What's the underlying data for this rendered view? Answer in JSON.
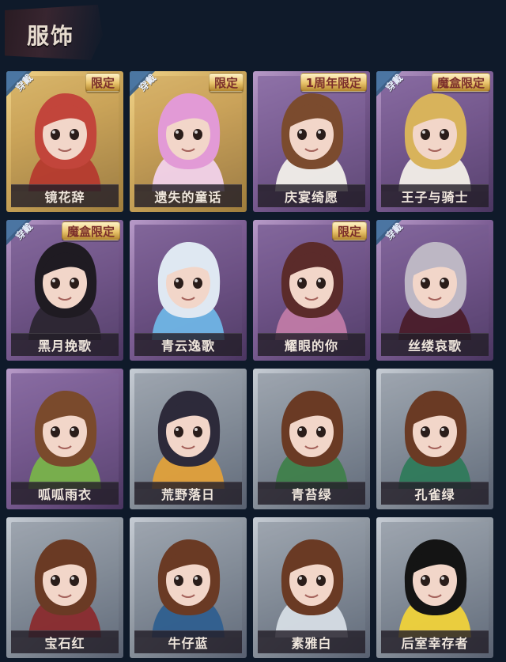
{
  "page": {
    "title": "服饰"
  },
  "badges": {
    "worn": "穿戴"
  },
  "items": [
    {
      "name": "镜花辞",
      "frame": "gold",
      "worn": true,
      "limited": "限定",
      "hair": "#c2453b",
      "outfit": "#b53a2e",
      "bg": "#d8b46a"
    },
    {
      "name": "遗失的童话",
      "frame": "gold",
      "worn": true,
      "limited": "限定",
      "hair": "#e29ad6",
      "outfit": "#f1d2ea",
      "bg": "#d6b26c"
    },
    {
      "name": "庆宴绮愿",
      "frame": "purple",
      "worn": false,
      "limited": "1周年限定",
      "hair": "#7b4b2e",
      "outfit": "#f2f0ea",
      "bg": "#8b6fa6"
    },
    {
      "name": "王子与骑士",
      "frame": "purple",
      "worn": true,
      "limited": "魔盒限定",
      "hair": "#d8b35b",
      "outfit": "#f3efe8",
      "bg": "#7c5f95"
    },
    {
      "name": "黑月挽歌",
      "frame": "purple",
      "worn": true,
      "limited": "魔盒限定",
      "hair": "#1f1b22",
      "outfit": "#2b2530",
      "bg": "#73588a"
    },
    {
      "name": "青云逸歌",
      "frame": "purple",
      "worn": false,
      "limited": "",
      "hair": "#dfe8f2",
      "outfit": "#6fb5e6",
      "bg": "#6a4f82"
    },
    {
      "name": "耀眼的你",
      "frame": "purple",
      "worn": false,
      "limited": "限定",
      "hair": "#5b2b2a",
      "outfit": "#c07aa6",
      "bg": "#6e5286"
    },
    {
      "name": "丝缕哀歌",
      "frame": "purple",
      "worn": true,
      "limited": "",
      "hair": "#bdb7c4",
      "outfit": "#4a1c2a",
      "bg": "#6e5286"
    },
    {
      "name": "呱呱雨衣",
      "frame": "purple",
      "worn": false,
      "limited": "",
      "hair": "#7a4a2c",
      "outfit": "#79b34a",
      "bg": "#7d6098"
    },
    {
      "name": "荒野落日",
      "frame": "gray",
      "worn": false,
      "limited": "",
      "hair": "#2d2a3a",
      "outfit": "#e0a03a",
      "bg": "#8d95a0"
    },
    {
      "name": "青苔绿",
      "frame": "gray",
      "worn": false,
      "limited": "",
      "hair": "#6a3a24",
      "outfit": "#3f7f4b",
      "bg": "#8d95a0"
    },
    {
      "name": "孔雀绿",
      "frame": "gray",
      "worn": false,
      "limited": "",
      "hair": "#6a3a24",
      "outfit": "#2f7a5b",
      "bg": "#8d95a0"
    },
    {
      "name": "宝石红",
      "frame": "gray",
      "worn": false,
      "limited": "",
      "hair": "#6a3a24",
      "outfit": "#8a2b2e",
      "bg": "#8d95a0"
    },
    {
      "name": "牛仔蓝",
      "frame": "gray",
      "worn": false,
      "limited": "",
      "hair": "#6a3a24",
      "outfit": "#2f5f8f",
      "bg": "#8d95a0"
    },
    {
      "name": "素雅白",
      "frame": "gray",
      "worn": false,
      "limited": "",
      "hair": "#6a3a24",
      "outfit": "#d6dde5",
      "bg": "#8d95a0"
    },
    {
      "name": "后室幸存者",
      "frame": "gray",
      "worn": false,
      "limited": "",
      "hair": "#141414",
      "outfit": "#f0d23a",
      "bg": "#8d95a0"
    }
  ]
}
